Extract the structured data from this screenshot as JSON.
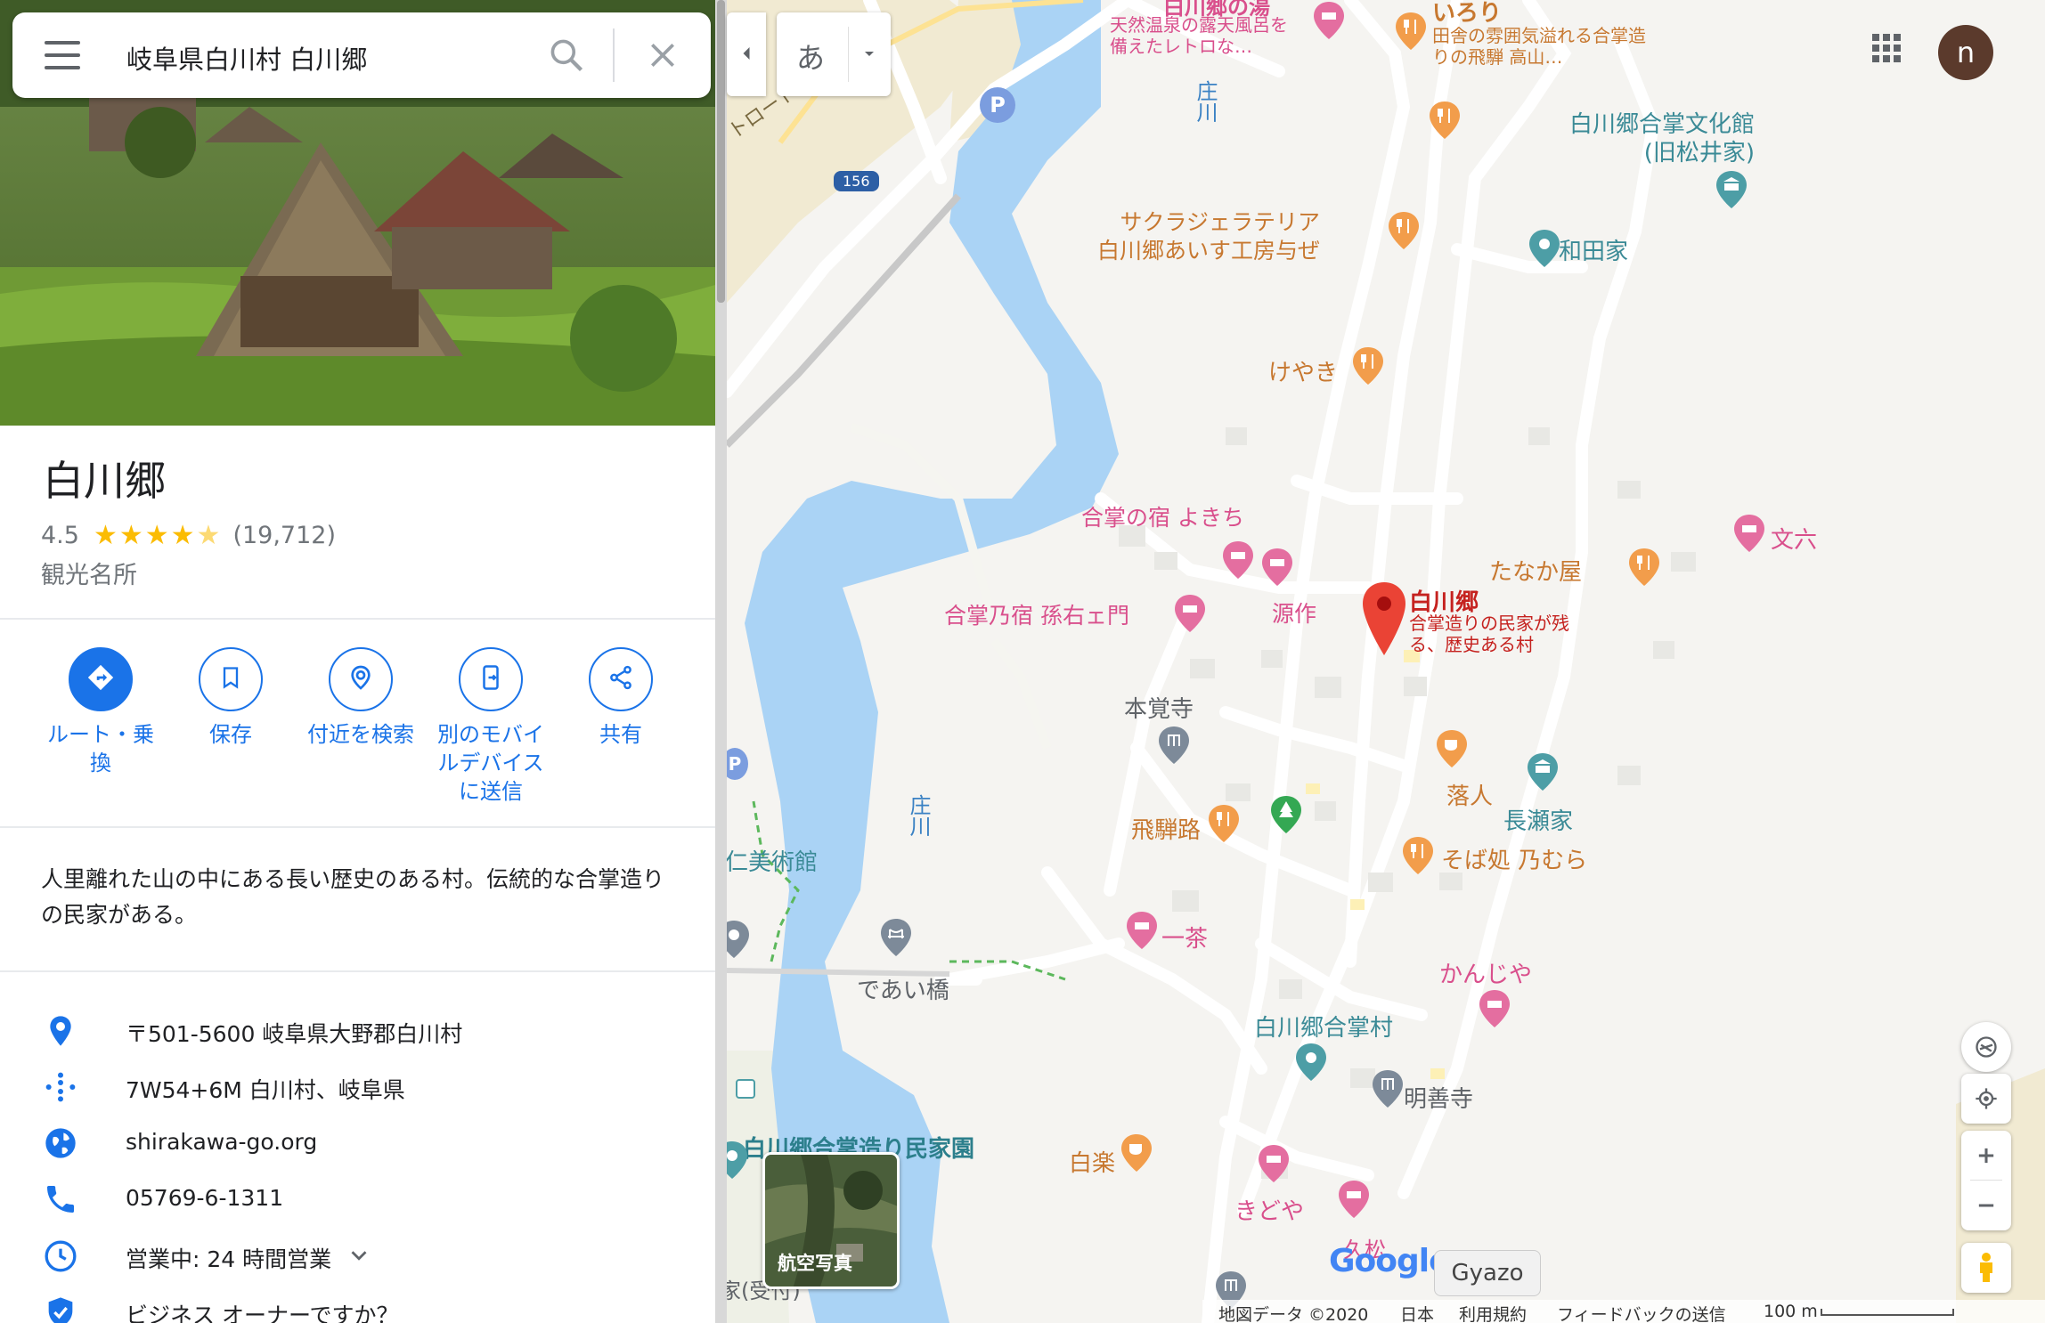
{
  "search": {
    "query": "岐阜県白川村 白川郷"
  },
  "place": {
    "name": "白川郷",
    "rating": "4.5",
    "stars": "★★★★",
    "half_star": "★",
    "reviews": "(19,712)",
    "category": "観光名所",
    "description": "人里離れた山の中にある長い歴史のある村。伝統的な合掌造りの民家がある。"
  },
  "actions": [
    {
      "label": "ルート・乗換",
      "icon": "directions-icon"
    },
    {
      "label": "保存",
      "icon": "bookmark-icon"
    },
    {
      "label": "付近を検索",
      "icon": "nearby-icon"
    },
    {
      "label": "別のモバイルデバイスに送信",
      "icon": "send-to-phone-icon"
    },
    {
      "label": "共有",
      "icon": "share-icon"
    }
  ],
  "info": {
    "address": "〒501-5600 岐阜県大野郡白川村",
    "plus_code": "7W54+6M 白川村、岐阜県",
    "website": "shirakawa-go.org",
    "phone": "05769-6-1311",
    "hours": "営業中: 24 時間営業",
    "owner": "ビジネス オーナーですか？"
  },
  "map": {
    "ime_label": "あ",
    "avatar_letter": "n",
    "aerial_label": "航空写真",
    "gyazo_label": "Gyazo",
    "google": "Google",
    "route_badge": "156",
    "parking": "P",
    "places": {
      "onsen_title": "白川郷の湯",
      "onsen_desc": "天然温泉の露天風呂を備えたレトロな…",
      "irori_title": "いろり",
      "irori_desc": "田舎の雰囲気溢れる合掌造りの飛騨 高山…",
      "matsui": "白川郷合掌文化館(旧松井家)",
      "sakura": "サクラジェラテリア 白川郷あいす工房与ぜ",
      "wada": "和田家",
      "keyaki": "けやき",
      "yokichi": "合掌の宿 よきち",
      "magoemon": "合掌乃宿 孫右ェ門",
      "gensaku": "源作",
      "tanakaya": "たなか屋",
      "bunroku": "文六",
      "main_title": "白川郷",
      "main_desc": "合掌造りの民家が残る、歴史ある村",
      "honkakuji": "本覚寺",
      "ochiudo": "落人",
      "nagase": "長瀬家",
      "hidaji": "飛騨路",
      "nomura": "そば処 乃むら",
      "bijutsukan": "仁美術館",
      "deaibashi": "であい橋",
      "issa": "一茶",
      "kanjiya": "かんじや",
      "gassho_mura": "白川郷合掌村",
      "myozenji": "明善寺",
      "minkaen": "白川郷合掌造り民家園",
      "hakuraku": "白楽",
      "kidoya": "きどや",
      "hisamatsu": "久松",
      "river1": "庄川",
      "river2": "庄川",
      "road": "トロード",
      "uketori": "家(受付)"
    },
    "footer": {
      "data": "地図データ ©2020",
      "country": "日本",
      "terms": "利用規約",
      "feedback": "フィードバックの送信",
      "scale": "100 m"
    }
  },
  "colors": {
    "accent": "#1a73e8",
    "pin": "#ea4335",
    "food": "#f29d4b",
    "hotel": "#e46ea0",
    "culture": "#4d9ea6",
    "water": "#aad3f5"
  }
}
